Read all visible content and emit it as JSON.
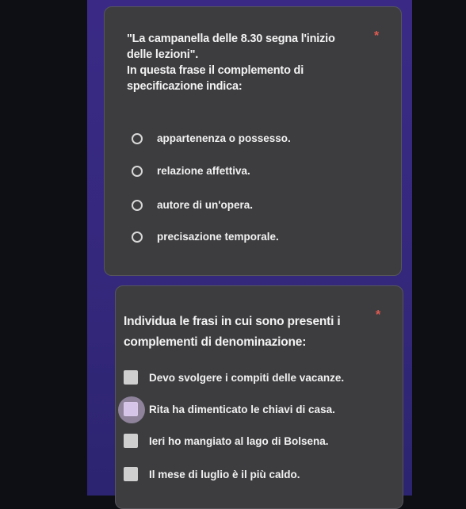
{
  "question1": {
    "text_line1": "\"La campanella delle 8.30 segna l'inizio",
    "text_line2": "delle lezioni\".",
    "text_line3": "In questa frase il complemento di",
    "text_line4": "specificazione indica:",
    "required_mark": "*",
    "options": [
      {
        "label": "appartenenza o possesso."
      },
      {
        "label": "relazione affettiva."
      },
      {
        "label": "autore di un'opera."
      },
      {
        "label": "precisazione temporale."
      }
    ]
  },
  "question2": {
    "text_line1": "Individua le frasi in cui sono presenti i",
    "text_line2": "complementi di denominazione:",
    "required_mark": "*",
    "options": [
      {
        "label": "Devo svolgere i compiti delle vacanze."
      },
      {
        "label": "Rita ha dimenticato le chiavi di casa."
      },
      {
        "label": "Ieri ho mangiato al lago di Bolsena."
      },
      {
        "label": "Il mese di luglio è il più caldo."
      }
    ]
  },
  "colors": {
    "required": "#e05a4f",
    "card": "#3d3d40",
    "accent_bg": "#3a2a86"
  }
}
